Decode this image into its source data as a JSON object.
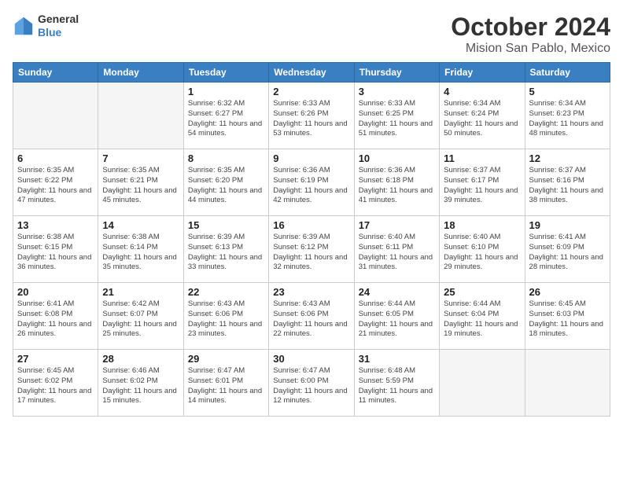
{
  "header": {
    "logo": {
      "line1": "General",
      "line2": "Blue"
    },
    "title": "October 2024",
    "subtitle": "Mision San Pablo, Mexico"
  },
  "weekdays": [
    "Sunday",
    "Monday",
    "Tuesday",
    "Wednesday",
    "Thursday",
    "Friday",
    "Saturday"
  ],
  "weeks": [
    [
      {
        "day": null,
        "info": null
      },
      {
        "day": null,
        "info": null
      },
      {
        "day": "1",
        "info": "Sunrise: 6:32 AM\nSunset: 6:27 PM\nDaylight: 11 hours and 54 minutes."
      },
      {
        "day": "2",
        "info": "Sunrise: 6:33 AM\nSunset: 6:26 PM\nDaylight: 11 hours and 53 minutes."
      },
      {
        "day": "3",
        "info": "Sunrise: 6:33 AM\nSunset: 6:25 PM\nDaylight: 11 hours and 51 minutes."
      },
      {
        "day": "4",
        "info": "Sunrise: 6:34 AM\nSunset: 6:24 PM\nDaylight: 11 hours and 50 minutes."
      },
      {
        "day": "5",
        "info": "Sunrise: 6:34 AM\nSunset: 6:23 PM\nDaylight: 11 hours and 48 minutes."
      }
    ],
    [
      {
        "day": "6",
        "info": "Sunrise: 6:35 AM\nSunset: 6:22 PM\nDaylight: 11 hours and 47 minutes."
      },
      {
        "day": "7",
        "info": "Sunrise: 6:35 AM\nSunset: 6:21 PM\nDaylight: 11 hours and 45 minutes."
      },
      {
        "day": "8",
        "info": "Sunrise: 6:35 AM\nSunset: 6:20 PM\nDaylight: 11 hours and 44 minutes."
      },
      {
        "day": "9",
        "info": "Sunrise: 6:36 AM\nSunset: 6:19 PM\nDaylight: 11 hours and 42 minutes."
      },
      {
        "day": "10",
        "info": "Sunrise: 6:36 AM\nSunset: 6:18 PM\nDaylight: 11 hours and 41 minutes."
      },
      {
        "day": "11",
        "info": "Sunrise: 6:37 AM\nSunset: 6:17 PM\nDaylight: 11 hours and 39 minutes."
      },
      {
        "day": "12",
        "info": "Sunrise: 6:37 AM\nSunset: 6:16 PM\nDaylight: 11 hours and 38 minutes."
      }
    ],
    [
      {
        "day": "13",
        "info": "Sunrise: 6:38 AM\nSunset: 6:15 PM\nDaylight: 11 hours and 36 minutes."
      },
      {
        "day": "14",
        "info": "Sunrise: 6:38 AM\nSunset: 6:14 PM\nDaylight: 11 hours and 35 minutes."
      },
      {
        "day": "15",
        "info": "Sunrise: 6:39 AM\nSunset: 6:13 PM\nDaylight: 11 hours and 33 minutes."
      },
      {
        "day": "16",
        "info": "Sunrise: 6:39 AM\nSunset: 6:12 PM\nDaylight: 11 hours and 32 minutes."
      },
      {
        "day": "17",
        "info": "Sunrise: 6:40 AM\nSunset: 6:11 PM\nDaylight: 11 hours and 31 minutes."
      },
      {
        "day": "18",
        "info": "Sunrise: 6:40 AM\nSunset: 6:10 PM\nDaylight: 11 hours and 29 minutes."
      },
      {
        "day": "19",
        "info": "Sunrise: 6:41 AM\nSunset: 6:09 PM\nDaylight: 11 hours and 28 minutes."
      }
    ],
    [
      {
        "day": "20",
        "info": "Sunrise: 6:41 AM\nSunset: 6:08 PM\nDaylight: 11 hours and 26 minutes."
      },
      {
        "day": "21",
        "info": "Sunrise: 6:42 AM\nSunset: 6:07 PM\nDaylight: 11 hours and 25 minutes."
      },
      {
        "day": "22",
        "info": "Sunrise: 6:43 AM\nSunset: 6:06 PM\nDaylight: 11 hours and 23 minutes."
      },
      {
        "day": "23",
        "info": "Sunrise: 6:43 AM\nSunset: 6:06 PM\nDaylight: 11 hours and 22 minutes."
      },
      {
        "day": "24",
        "info": "Sunrise: 6:44 AM\nSunset: 6:05 PM\nDaylight: 11 hours and 21 minutes."
      },
      {
        "day": "25",
        "info": "Sunrise: 6:44 AM\nSunset: 6:04 PM\nDaylight: 11 hours and 19 minutes."
      },
      {
        "day": "26",
        "info": "Sunrise: 6:45 AM\nSunset: 6:03 PM\nDaylight: 11 hours and 18 minutes."
      }
    ],
    [
      {
        "day": "27",
        "info": "Sunrise: 6:45 AM\nSunset: 6:02 PM\nDaylight: 11 hours and 17 minutes."
      },
      {
        "day": "28",
        "info": "Sunrise: 6:46 AM\nSunset: 6:02 PM\nDaylight: 11 hours and 15 minutes."
      },
      {
        "day": "29",
        "info": "Sunrise: 6:47 AM\nSunset: 6:01 PM\nDaylight: 11 hours and 14 minutes."
      },
      {
        "day": "30",
        "info": "Sunrise: 6:47 AM\nSunset: 6:00 PM\nDaylight: 11 hours and 12 minutes."
      },
      {
        "day": "31",
        "info": "Sunrise: 6:48 AM\nSunset: 5:59 PM\nDaylight: 11 hours and 11 minutes."
      },
      {
        "day": null,
        "info": null
      },
      {
        "day": null,
        "info": null
      }
    ]
  ]
}
